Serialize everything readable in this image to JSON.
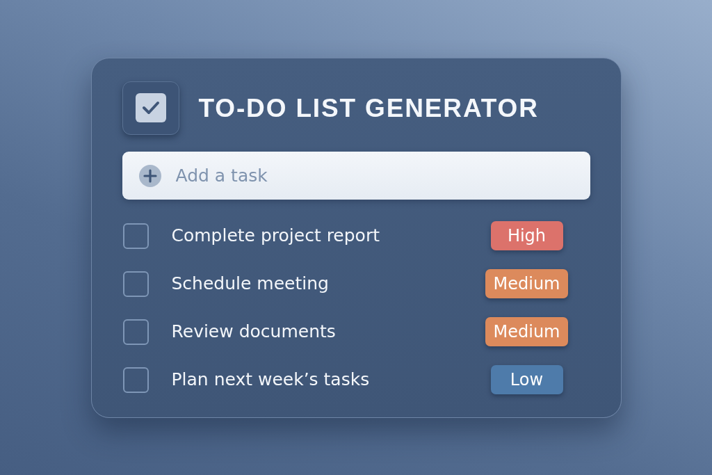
{
  "app": {
    "title": "TO-DO LIST GENERATOR"
  },
  "new_task": {
    "placeholder": "Add a task"
  },
  "tasks": [
    {
      "title": "Complete project report",
      "checked": false,
      "priority": "High",
      "color": "#dc726b"
    },
    {
      "title": "Schedule meeting",
      "checked": false,
      "priority": "Medium",
      "color": "#dc8a5c"
    },
    {
      "title": "Review documents",
      "checked": false,
      "priority": "Medium",
      "color": "#dc8a5c"
    },
    {
      "title": "Plan next week’s tasks",
      "checked": false,
      "priority": "Low",
      "color": "#4e7baa"
    }
  ]
}
